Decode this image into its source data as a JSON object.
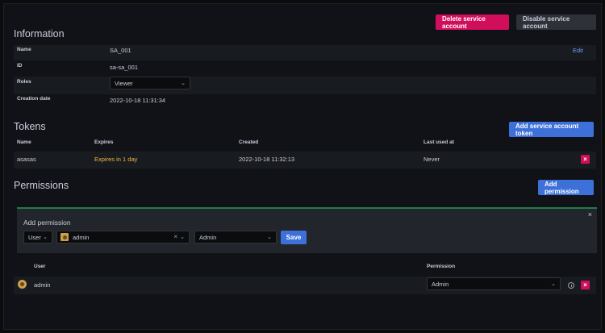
{
  "header": {
    "delete_label": "Delete service account",
    "disable_label": "Disable service account"
  },
  "information": {
    "title": "Information",
    "name_label": "Name",
    "name_value": "SA_001",
    "edit_label": "Edit",
    "id_label": "ID",
    "id_value": "sa-sa_001",
    "roles_label": "Roles",
    "roles_value": "Viewer",
    "created_label": "Creation date",
    "created_value": "2022-10-18 11:31:34"
  },
  "tokens": {
    "title": "Tokens",
    "add_label": "Add service account token",
    "columns": [
      "Name",
      "Expires",
      "Created",
      "Last used at"
    ],
    "rows": [
      {
        "name": "asasas",
        "expires": "Expires in 1 day",
        "created": "2022-10-18 11:32:13",
        "last_used": "Never"
      }
    ]
  },
  "permissions": {
    "title": "Permissions",
    "add_label": "Add permission",
    "panel_title": "Add permission",
    "type_value": "User",
    "user_value": "admin",
    "perm_value": "Admin",
    "save_label": "Save",
    "columns": [
      "User",
      "Permission"
    ],
    "rows": [
      {
        "user": "admin",
        "permission": "Admin"
      }
    ]
  },
  "colors": {
    "danger": "#d10e5c",
    "primary": "#3d71d9",
    "warning": "#f5b73d",
    "panel_accent": "#1a7f4b"
  },
  "icons": [
    "chevron-down-icon",
    "close-icon",
    "clear-icon",
    "avatar-icon",
    "info-icon"
  ]
}
